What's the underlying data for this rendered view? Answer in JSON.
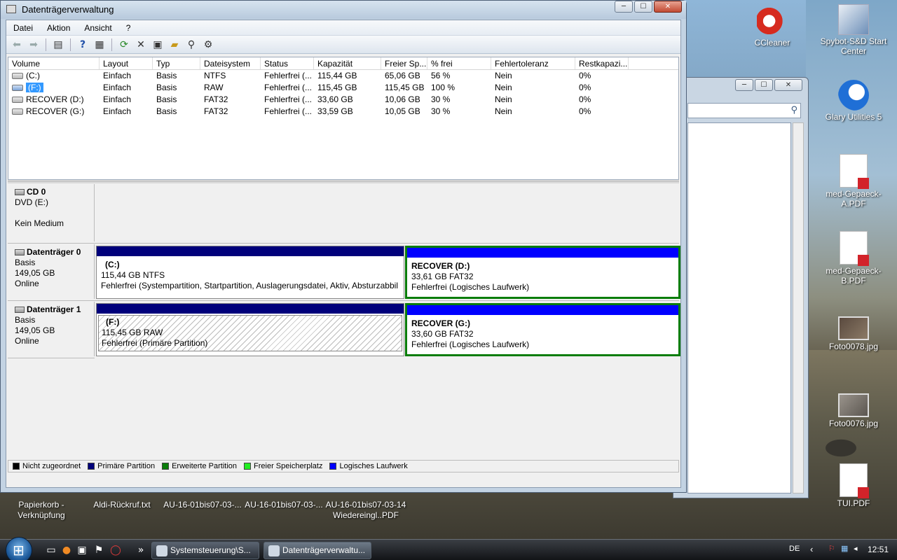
{
  "window": {
    "title": "Datenträgerverwaltung",
    "caption_buttons": [
      "─",
      "☐",
      "✕"
    ]
  },
  "menu": [
    "Datei",
    "Aktion",
    "Ansicht",
    "?"
  ],
  "toolbar": {
    "icons": [
      "back-arrow-icon",
      "forward-arrow-icon",
      "console-tree-icon",
      "help-icon",
      "properties-icon",
      "refresh-icon",
      "delete-icon",
      "export-icon",
      "open-folder-icon",
      "search-icon",
      "settings-icon"
    ]
  },
  "volume_table": {
    "headers": [
      "Volume",
      "Layout",
      "Typ",
      "Dateisystem",
      "Status",
      "Kapazität",
      "Freier Sp...",
      "% frei",
      "Fehlertoleranz",
      "Restkapazi..."
    ],
    "rows": [
      [
        "(C:)",
        "Einfach",
        "Basis",
        "NTFS",
        "Fehlerfrei (...",
        "115,44 GB",
        "65,06 GB",
        "56 %",
        "Nein",
        "0%"
      ],
      [
        "(F:)",
        "Einfach",
        "Basis",
        "RAW",
        "Fehlerfrei (...",
        "115,45 GB",
        "115,45 GB",
        "100 %",
        "Nein",
        "0%"
      ],
      [
        "RECOVER (D:)",
        "Einfach",
        "Basis",
        "FAT32",
        "Fehlerfrei (...",
        "33,60 GB",
        "10,06 GB",
        "30 %",
        "Nein",
        "0%"
      ],
      [
        "RECOVER (G:)",
        "Einfach",
        "Basis",
        "FAT32",
        "Fehlerfrei (...",
        "33,59 GB",
        "10,05 GB",
        "30 %",
        "Nein",
        "0%"
      ]
    ]
  },
  "disks": {
    "cd0": {
      "name": "CD 0",
      "type": "DVD (E:)",
      "status": "Kein Medium"
    },
    "disk0": {
      "name": "Datenträger 0",
      "type": "Basis",
      "size": "149,05 GB",
      "state": "Online",
      "p1": {
        "name": "(C:)",
        "size": "115,44 GB NTFS",
        "status": "Fehlerfrei (Systempartition, Startpartition, Auslagerungsdatei, Aktiv, Absturzabbil"
      },
      "p2": {
        "name": "RECOVER  (D:)",
        "size": "33,61 GB FAT32",
        "status": "Fehlerfrei (Logisches Laufwerk)"
      }
    },
    "disk1": {
      "name": "Datenträger 1",
      "type": "Basis",
      "size": "149,05 GB",
      "state": "Online",
      "p1": {
        "name": "(F:)",
        "size": "115,45 GB RAW",
        "status": "Fehlerfrei (Primäre Partition)"
      },
      "p2": {
        "name": "RECOVER  (G:)",
        "size": "33,60 GB FAT32",
        "status": "Fehlerfrei (Logisches Laufwerk)"
      }
    }
  },
  "legend": [
    {
      "label": "Nicht zugeordnet",
      "color": "#000000"
    },
    {
      "label": "Primäre Partition",
      "color": "#00007b"
    },
    {
      "label": "Erweiterte Partition",
      "color": "#0a7d0a"
    },
    {
      "label": "Freier Speicherplatz",
      "color": "#22ee22"
    },
    {
      "label": "Logisches Laufwerk",
      "color": "#0000ff"
    }
  ],
  "desktop_icons": {
    "ccleaner": "CCleaner",
    "spybot": "Spybot-S&D Start Center",
    "glary": "Glary Utilities 5",
    "pdf_a": "med-Gepaeck-A.PDF",
    "pdf_b": "med-Gepaeck-B.PDF",
    "foto78": "Foto0078.jpg",
    "foto76": "Foto0076.jpg",
    "tui": "TUI.PDF",
    "papierkorb": "Papierkorb - Verknüpfung",
    "aldi": "Aldi-Rückruf.txt",
    "au1": "AU-16-01bis07-03-...",
    "au2": "AU-16-01bis07-03-...",
    "au3": "AU-16-01bis07-03-14 Wiedereingl..PDF"
  },
  "taskbar": {
    "buttons": [
      "Systemsteuerung\\S...",
      "Datenträgerverwaltu..."
    ],
    "overflow": "»",
    "language": "DE",
    "clock": "12:51"
  }
}
